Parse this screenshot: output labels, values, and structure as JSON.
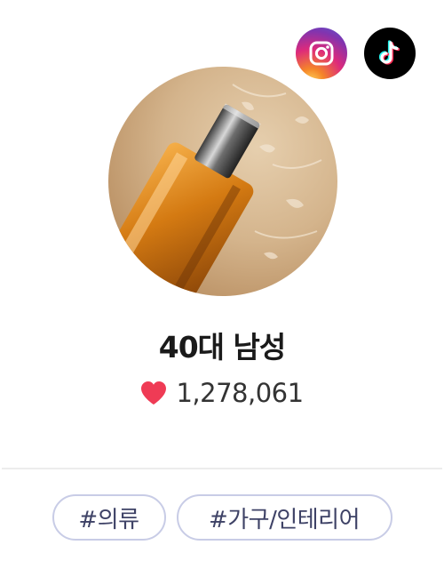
{
  "social": {
    "instagram_icon": "instagram-icon",
    "tiktok_icon": "tiktok-icon"
  },
  "profile": {
    "name": "40대 남성",
    "likes": "1,278,061",
    "heart_color": "#ef3b55"
  },
  "tags": [
    {
      "label": "#의류"
    },
    {
      "label": "#가구/인테리어"
    }
  ]
}
